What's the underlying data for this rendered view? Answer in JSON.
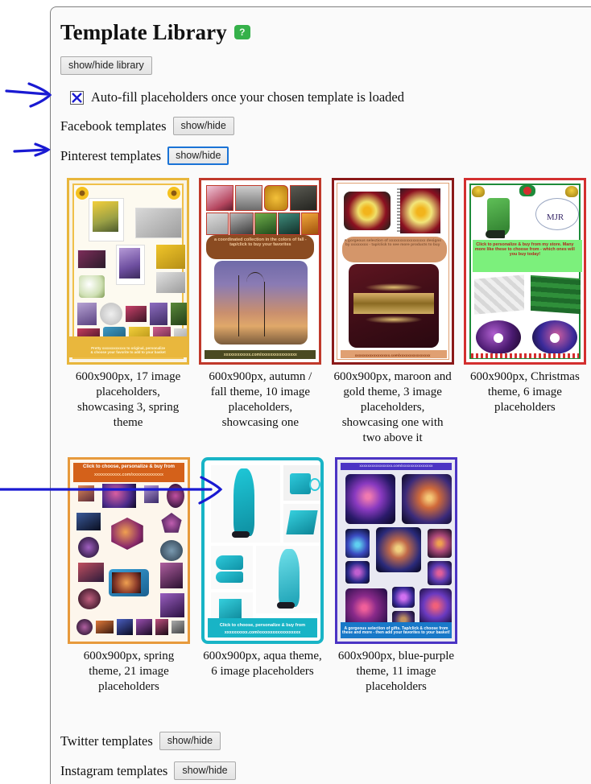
{
  "header": {
    "title": "Template Library",
    "help_badge": "?",
    "help_badge_color": "#35b14a"
  },
  "toolbar": {
    "library_toggle_label": "show/hide library"
  },
  "autofill": {
    "checked": true,
    "check_mark": "X",
    "label": "Auto-fill placeholders once your chosen template is loaded",
    "mark_color": "#1a1ad2"
  },
  "networks": [
    {
      "name": "facebook",
      "label": "Facebook templates",
      "button": "show/hide",
      "focused": false
    },
    {
      "name": "pinterest",
      "label": "Pinterest templates",
      "button": "show/hide",
      "focused": true
    },
    {
      "name": "twitter",
      "label": "Twitter templates",
      "button": "show/hide",
      "focused": false
    },
    {
      "name": "instagram",
      "label": "Instagram templates",
      "button": "show/hide",
      "focused": false
    }
  ],
  "templates": [
    {
      "id": "spring-17",
      "caption": "600x900px, 17 image placeholders, showcasing 3, spring theme",
      "theme": "spring",
      "size": "600x900px",
      "placeholders": 17,
      "border_color": "#e8b63c",
      "inner_bg": "#f7f2e4",
      "banner_text": "Pretty xxxxxxxxxxxx to original, personalize & choose your favorite to add to your basket",
      "banner_color": "#e9b73d"
    },
    {
      "id": "autumn-10",
      "caption": "600x900px, autumn / fall theme, 10 image placeholders, showcasing one",
      "theme": "autumn / fall",
      "size": "600x900px",
      "placeholders": 10,
      "border_color": "#c0392b",
      "inner_bg": "#ffffff",
      "banner_text": "a coordinated collection in the colors of fall - tap/click to buy your favorites",
      "banner_color": "#8a4b21",
      "url_strip": "xxxxxxxxxxxx.com/xxxxxxxxxxxxxxxx",
      "url_strip_color": "#4a4a22"
    },
    {
      "id": "maroon-3",
      "caption": "600x900px, maroon and gold theme, 3 image placeholders, showcasing one with two above it",
      "theme": "maroon and gold",
      "size": "600x900px",
      "placeholders": 3,
      "border_color": "#8b1a1a",
      "inner_bg": "#ffffff",
      "banner_text": "A gorgeous selection of xxxxxxxxxxxxxxxxx designs by xxxxxxxx - tap/click to see more products to buy",
      "banner_color": "#d4966a",
      "url_strip": "xxxxxxxxxxxxxxxxx.com/xxxxxxxxxxxxxxx",
      "url_strip_color": "#e0a072"
    },
    {
      "id": "christmas-6",
      "caption": "600x900px, Christmas theme, 6 image placeholders",
      "theme": "Christmas",
      "size": "600x900px",
      "placeholders": 6,
      "border_color": "#d32f2f",
      "inner_bg": "#ffffff",
      "banner_text": "Click to personalize & buy from my store. Many more like these to choose from - which ones will you buy today!",
      "banner_color": "#7cf07c",
      "banner_text_color": "#b3261e"
    },
    {
      "id": "spring-21",
      "caption": "600x900px, spring theme, 21 image placeholders",
      "theme": "spring",
      "size": "600x900px",
      "placeholders": 21,
      "border_color": "#e79a3c",
      "inner_bg": "#fdf6ec",
      "banner_text": "Click to choose, personalize & buy from",
      "banner_subtext": "xxxxxxxxxxx.com/xxxxxxxxxxxxx",
      "banner_color": "#d4611a"
    },
    {
      "id": "aqua-6",
      "caption": "600x900px, aqua theme, 6 image placeholders",
      "theme": "aqua",
      "size": "600x900px",
      "placeholders": 6,
      "border_color": "#18b4c6",
      "inner_bg": "#ffffff",
      "banner_text": "Click to choose, personalize & buy from",
      "banner_subtext": "xxxxxxxxxx.com/xxxxxxxxxxxxxxxxxx",
      "banner_color": "#18b4c6"
    },
    {
      "id": "blue-purple-11",
      "caption": "600x900px, blue-purple theme, 11 image placeholders",
      "theme": "blue-purple",
      "size": "600x900px",
      "placeholders": 11,
      "border_color": "#4b34c4",
      "inner_bg": "#e9e9f2",
      "banner_text": "A gorgeous selection of gifts. Tap/click & choose from these and more - then add your favorites to your basket!",
      "banner_color": "#1878c8",
      "url_strip": "xxxxxxxxxxxxxxxx.com/xxxxxxxxxxxxxxx",
      "url_strip_color": "#4b34c4"
    }
  ],
  "annotations": {
    "color": "#1a1ad2",
    "arrows": [
      {
        "name": "arrow-to-autofill-checkbox",
        "target": "autofill-checkbox"
      },
      {
        "name": "arrow-to-pinterest-button",
        "target": "pinterest-show-hide-button"
      },
      {
        "name": "arrow-to-aqua-template",
        "target": "template-aqua-6"
      }
    ]
  }
}
